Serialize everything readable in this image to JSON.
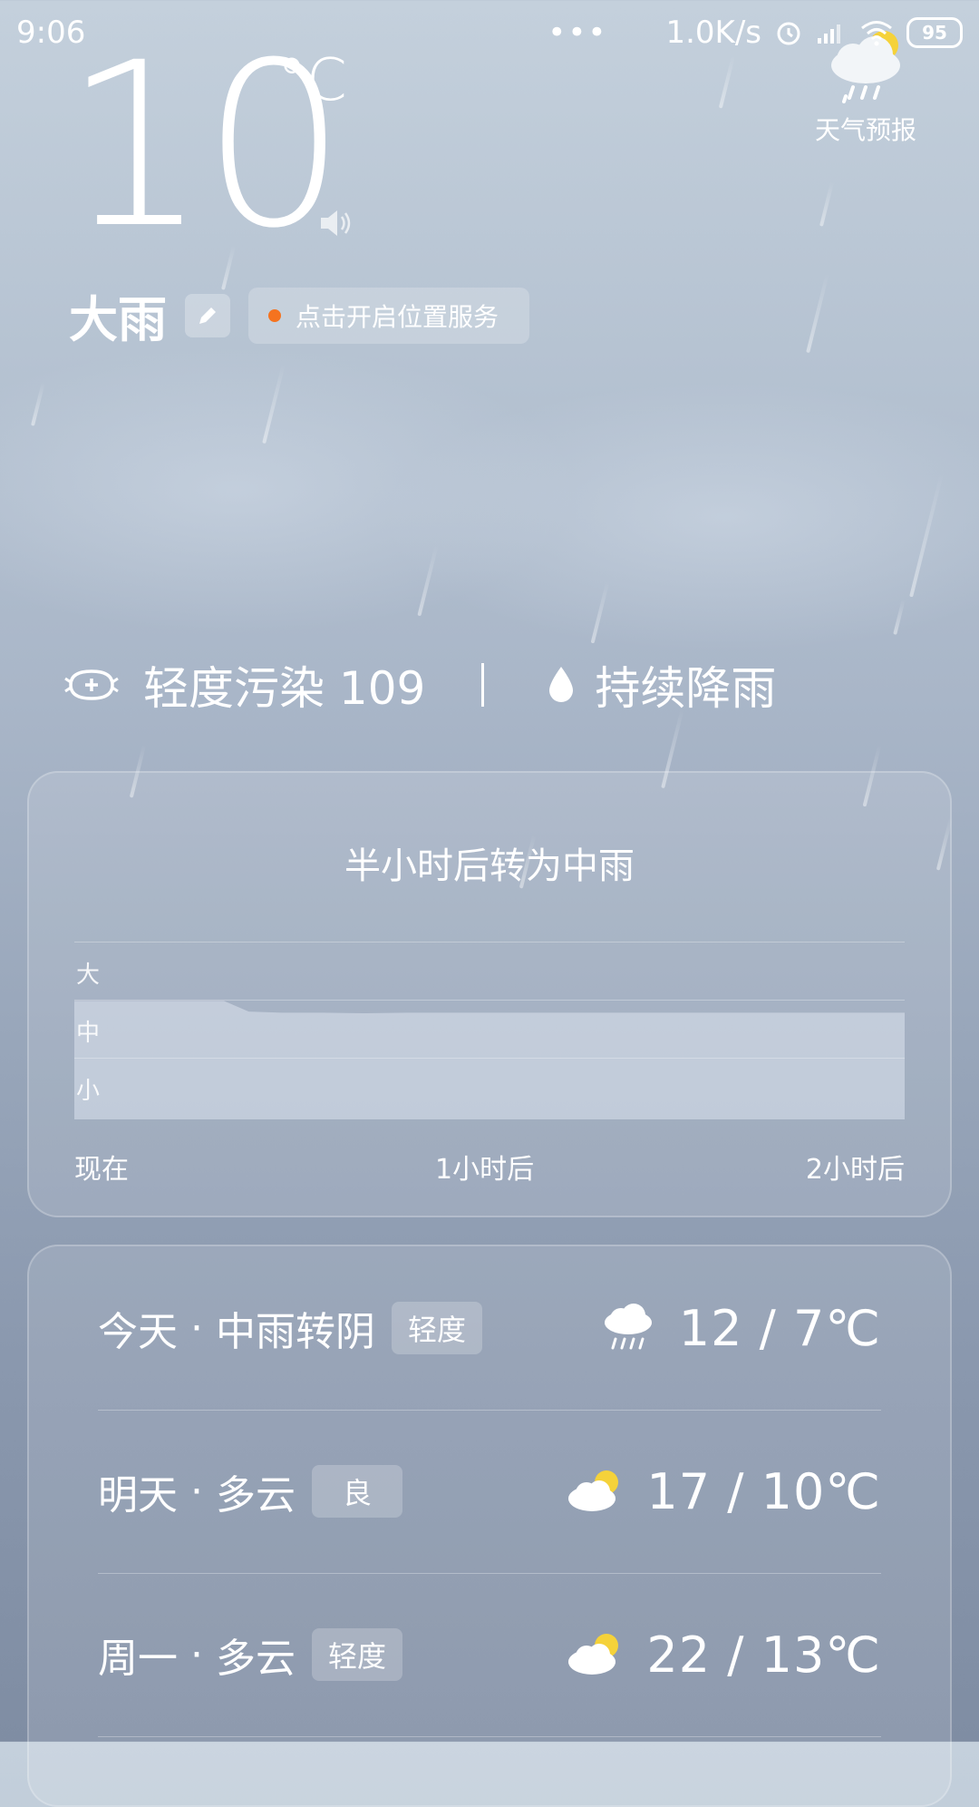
{
  "status_bar": {
    "time": "9:06",
    "more": "•••",
    "net_speed": "1.0K/s",
    "battery": "95"
  },
  "current": {
    "temperature": "10",
    "unit": "°C",
    "condition": "大雨",
    "location_hint": "点击开启位置服务"
  },
  "forecast_widget": {
    "label": "天气预报"
  },
  "aqi": {
    "text": "轻度污染 109",
    "rain_status": "持续降雨"
  },
  "precip": {
    "title": "半小时后转为中雨",
    "levels": [
      "大",
      "中",
      "小"
    ],
    "x_ticks": [
      "现在",
      "1小时后",
      "2小时后"
    ]
  },
  "chart_data": {
    "type": "area",
    "title": "半小时后转为中雨",
    "x": [
      0,
      0.1,
      0.2,
      0.3,
      0.36,
      0.42,
      0.5,
      0.6,
      0.7,
      0.8,
      0.9,
      1.0,
      1.25,
      1.5,
      1.75,
      2.0
    ],
    "y": [
      2.0,
      2.0,
      2.0,
      2.0,
      2.0,
      1.82,
      1.8,
      1.8,
      1.79,
      1.8,
      1.8,
      1.8,
      1.8,
      1.8,
      1.8,
      1.8
    ],
    "x_tick_labels": [
      "现在",
      "1小时后",
      "2小时后"
    ],
    "y_tick_labels": [
      "小",
      "中",
      "大"
    ],
    "xlim": [
      0,
      2
    ],
    "ylim": [
      0,
      3
    ],
    "grid": true
  },
  "daily": [
    {
      "day": "今天",
      "cond": "中雨转阴",
      "aqi": "轻度",
      "icon": "rain-cloud-icon",
      "temp": "12  /  7℃"
    },
    {
      "day": "明天",
      "cond": "多云",
      "aqi": "良",
      "icon": "partly-cloudy-icon",
      "temp": "17  /  10℃"
    },
    {
      "day": "周一",
      "cond": "多云",
      "aqi": "轻度",
      "icon": "partly-cloudy-icon",
      "temp": "22  /  13℃"
    }
  ],
  "colors": {
    "location_dot": "#f5731f",
    "sun": "#f5d23a"
  }
}
